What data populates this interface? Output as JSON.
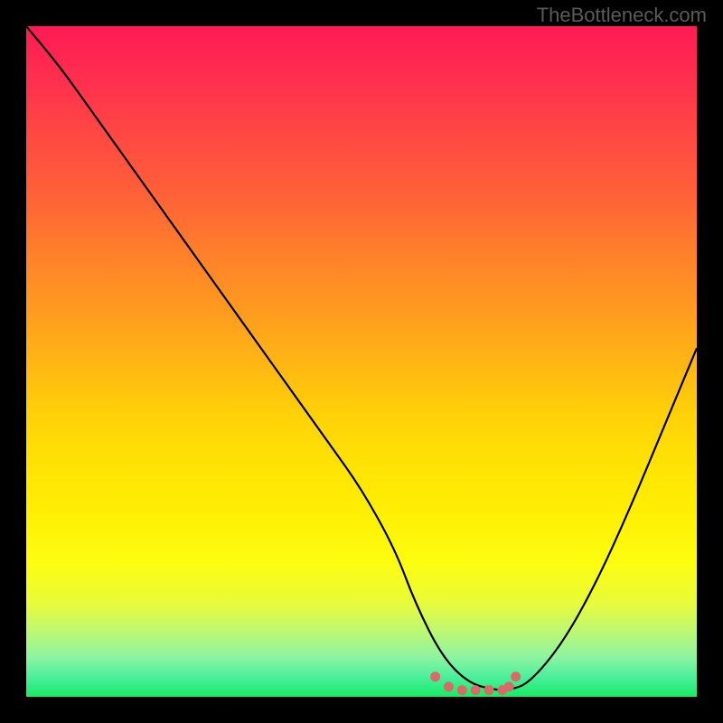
{
  "watermark": "TheBottleneck.com",
  "chart_data": {
    "type": "line",
    "title": "",
    "xlabel": "",
    "ylabel": "",
    "xlim": [
      0,
      100
    ],
    "ylim": [
      0,
      100
    ],
    "series": [
      {
        "name": "bottleneck-curve",
        "color": "#000000",
        "x": [
          0,
          5,
          10,
          15,
          20,
          25,
          30,
          35,
          40,
          45,
          50,
          55,
          58,
          62,
          66,
          70,
          72,
          75,
          80,
          85,
          90,
          95,
          100
        ],
        "y": [
          100,
          94,
          87,
          80,
          73,
          66,
          59,
          52,
          45,
          38,
          31,
          22,
          14,
          6,
          2,
          1,
          1,
          2,
          8,
          17,
          28,
          40,
          52
        ]
      }
    ],
    "marker_points": {
      "name": "optimal-range",
      "color": "#d96a6a",
      "x": [
        61,
        63,
        65,
        67,
        69,
        71,
        72,
        73
      ],
      "y": [
        3,
        1.5,
        1,
        1,
        1,
        1,
        1.5,
        3
      ]
    },
    "colors": {
      "gradient_top": "#ff1a55",
      "gradient_mid": "#ffe205",
      "gradient_bottom": "#18eb64",
      "curve": "#000000",
      "markers": "#d96a6a",
      "frame": "#000000"
    }
  }
}
